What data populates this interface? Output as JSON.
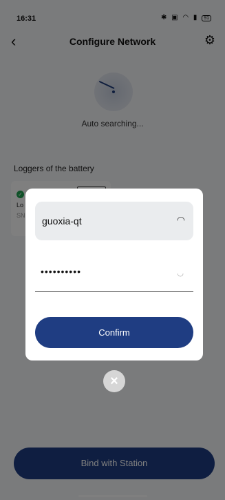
{
  "status_bar": {
    "time": "16:31",
    "icons": [
      "bluetooth-icon",
      "nfc-icon",
      "wifi-icon",
      "signal-icon"
    ],
    "battery": "91"
  },
  "header": {
    "back_icon": "chevron-left-icon",
    "title": "Configure Network",
    "settings_icon": "gear-icon"
  },
  "search": {
    "status": "Auto searching..."
  },
  "loggers": {
    "section_title": "Loggers of the battery",
    "items": [
      {
        "label": "Lo",
        "sn": "SN",
        "status": "connected"
      }
    ]
  },
  "bind_button": {
    "label": "Bind with Station"
  },
  "dialog": {
    "ssid": "guoxia-qt",
    "ssid_icon": "wifi-icon",
    "password_masked": "••••••••••",
    "password_icon": "eye-closed-icon",
    "confirm_label": "Confirm",
    "close_icon": "close-icon"
  },
  "colors": {
    "primary": "#1f3d82",
    "success": "#1fa351",
    "overlay": "rgba(0,0,0,0.5)"
  }
}
